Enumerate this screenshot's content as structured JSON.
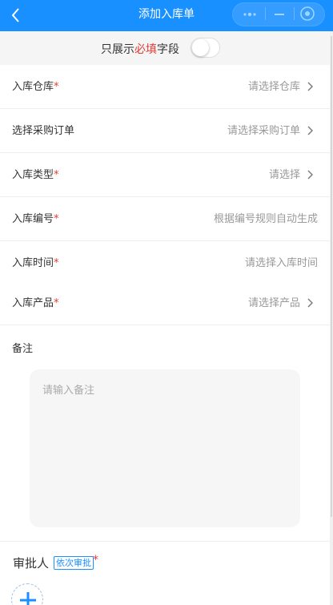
{
  "header": {
    "title": "添加入库单",
    "back_icon": "back-arrow-icon",
    "more_icon": "more-dots-icon",
    "minimize_icon": "minimize-icon",
    "close_icon": "target-close-icon",
    "bg_color": "#1890ff"
  },
  "filter": {
    "prefix": "只展示",
    "highlight": "必填",
    "suffix": "字段",
    "toggle_on": false
  },
  "form": {
    "rows": [
      {
        "label": "入库仓库",
        "required": "*",
        "value": "请选择仓库",
        "chevron": true
      },
      {
        "label": "选择采购订单",
        "required": "",
        "value": "请选择采购订单",
        "chevron": true
      },
      {
        "label": "入库类型",
        "required": "*",
        "value": "请选择",
        "chevron": true
      },
      {
        "label": "入库编号",
        "required": "*",
        "value": "根据编号规则自动生成",
        "chevron": false
      },
      {
        "label": "入库时间",
        "required": "*",
        "value": "请选择入库时间",
        "chevron": false
      },
      {
        "label": "入库产品",
        "required": "*",
        "value": "请选择产品",
        "chevron": true
      }
    ],
    "remark_label": "备注",
    "remark_placeholder": "请输入备注"
  },
  "approver": {
    "label": "审批人",
    "tag": "依次审批",
    "required": "*",
    "add_icon": "plus-icon"
  },
  "colors": {
    "accent": "#1890ff",
    "required": "#e53935"
  }
}
